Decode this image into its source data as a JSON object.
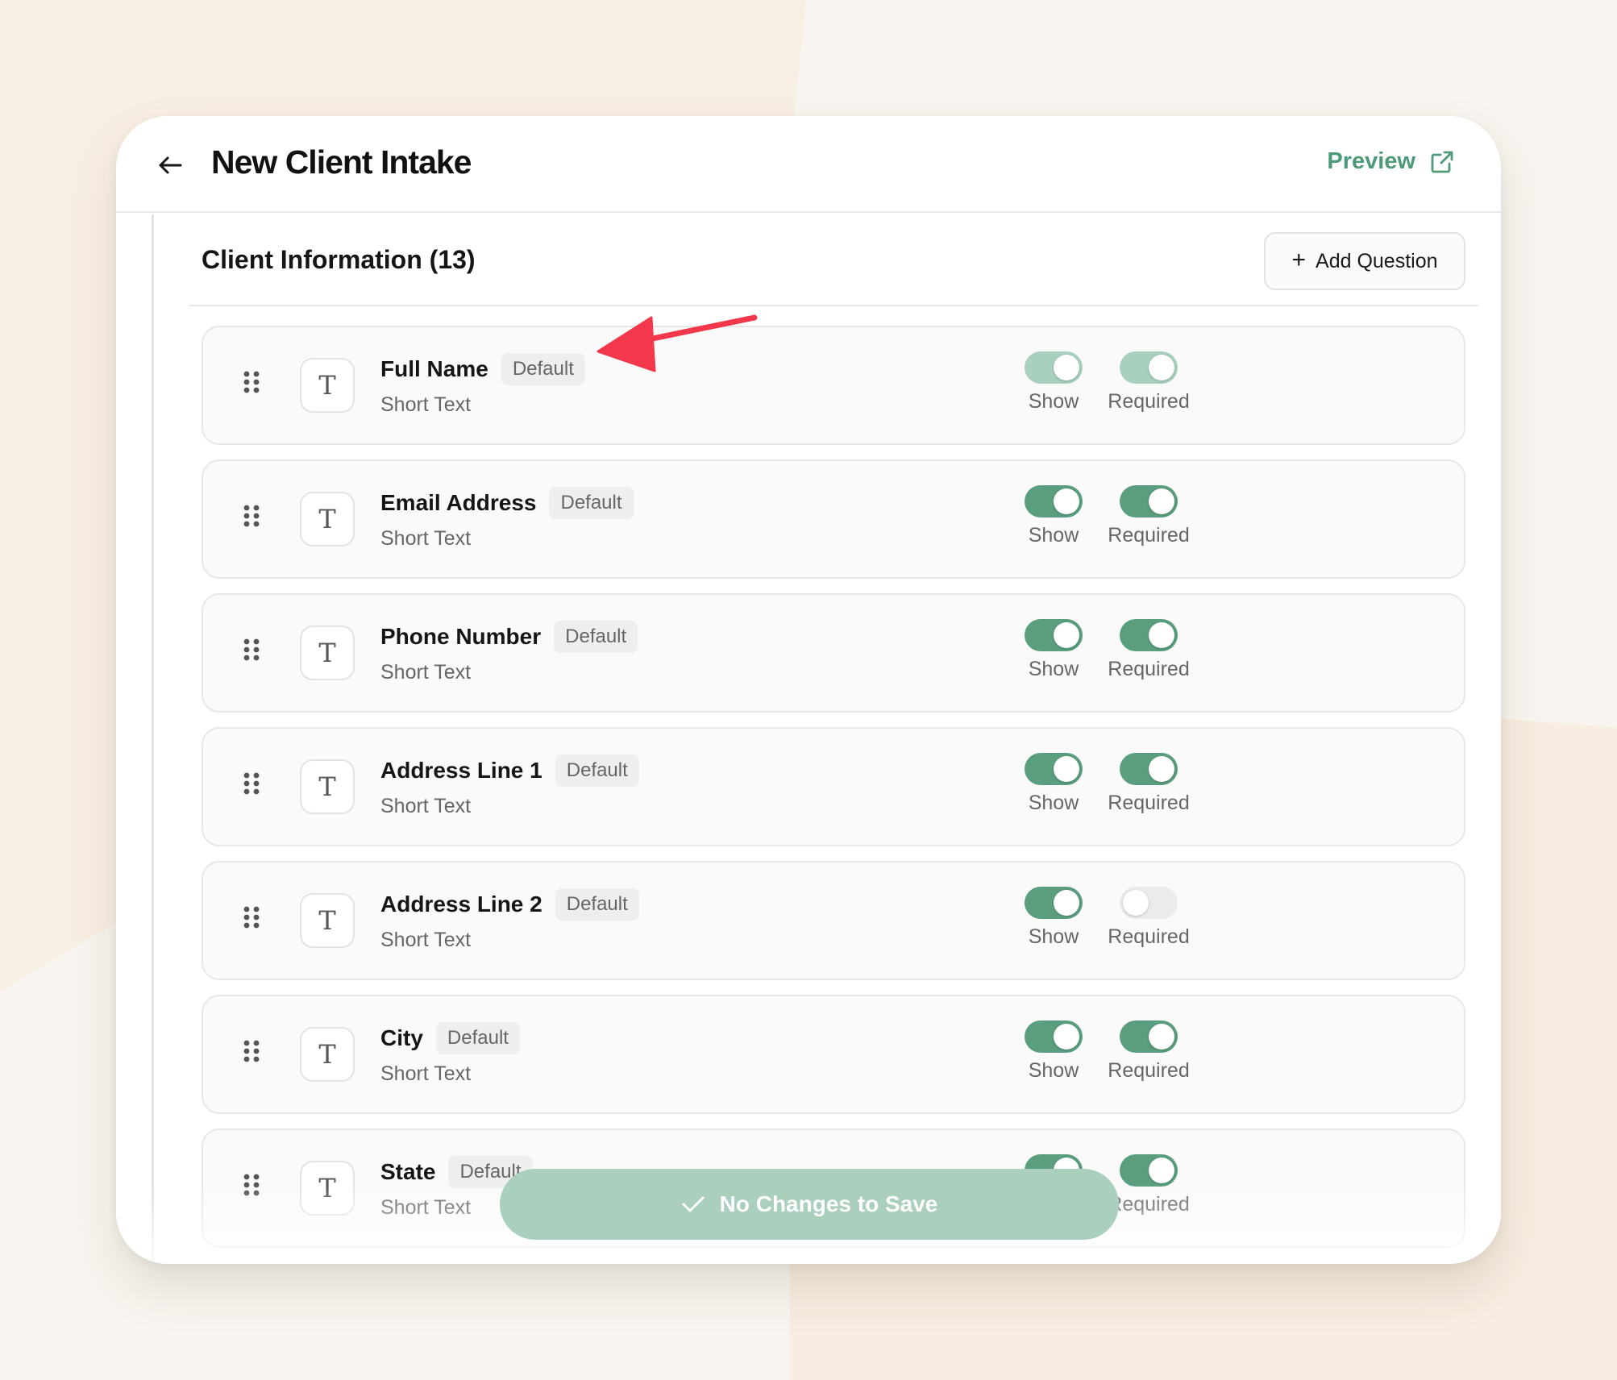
{
  "header": {
    "title": "New Client Intake",
    "preview_label": "Preview"
  },
  "section": {
    "title": "Client Information (13)",
    "add_label": "Add Question"
  },
  "toggle_labels": {
    "show": "Show",
    "required": "Required"
  },
  "questions": [
    {
      "name": "Full Name",
      "badge": "Default",
      "type": "Short Text",
      "show": true,
      "required": true,
      "locked": true
    },
    {
      "name": "Email Address",
      "badge": "Default",
      "type": "Short Text",
      "show": true,
      "required": true,
      "locked": false
    },
    {
      "name": "Phone Number",
      "badge": "Default",
      "type": "Short Text",
      "show": true,
      "required": true,
      "locked": false
    },
    {
      "name": "Address Line 1",
      "badge": "Default",
      "type": "Short Text",
      "show": true,
      "required": true,
      "locked": false
    },
    {
      "name": "Address Line 2",
      "badge": "Default",
      "type": "Short Text",
      "show": true,
      "required": false,
      "locked": false
    },
    {
      "name": "City",
      "badge": "Default",
      "type": "Short Text",
      "show": true,
      "required": true,
      "locked": false
    },
    {
      "name": "State",
      "badge": "Default",
      "type": "Short Text",
      "show": true,
      "required": true,
      "locked": false
    }
  ],
  "save_bar": {
    "label": "No Changes to Save"
  },
  "colors": {
    "accent": "#5a9e7f",
    "accent_disabled": "#a8d0bc",
    "annotation_arrow": "#f2384a"
  },
  "icons": {
    "back": "arrow-left-icon",
    "preview": "external-link-icon",
    "add": "plus-icon",
    "drag": "drag-handle-icon",
    "type": "text-type-icon",
    "save": "check-icon"
  }
}
